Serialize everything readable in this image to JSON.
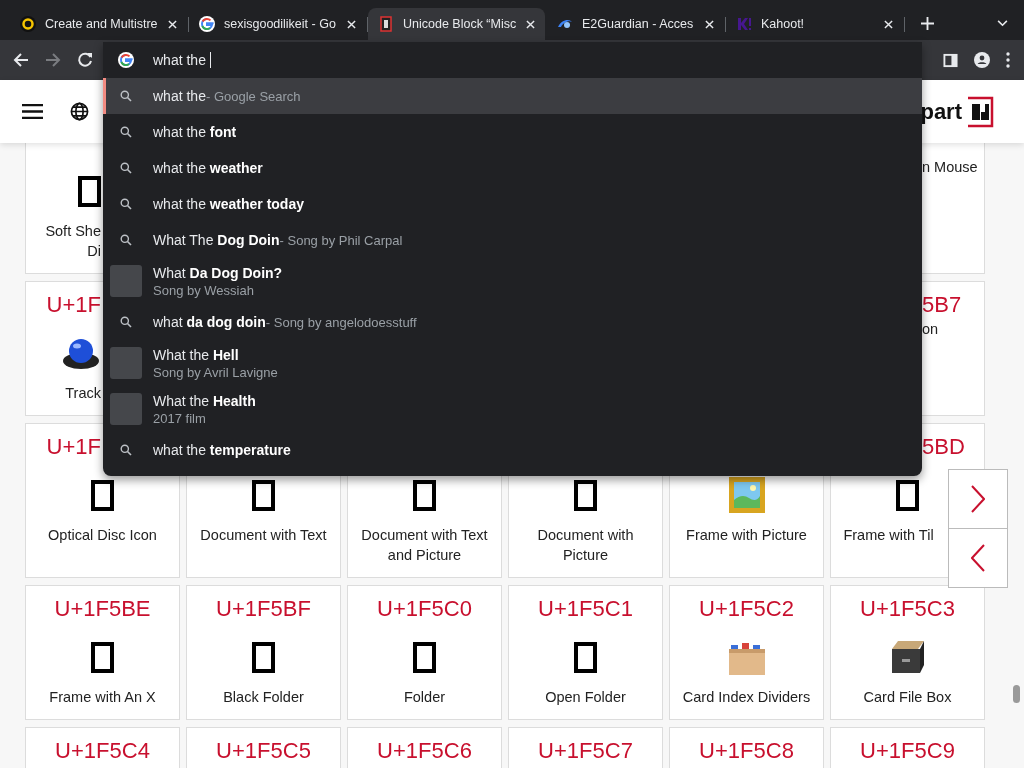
{
  "tabs": [
    {
      "title": "Create and Multistre",
      "kind": "ring",
      "selected": false
    },
    {
      "title": "sexisgoodilikeit - Go",
      "kind": "g",
      "selected": false
    },
    {
      "title": "Unicode Block “Misc",
      "kind": "frame",
      "selected": true
    },
    {
      "title": "E2Guardian - Acces",
      "kind": "swoosh",
      "selected": false
    },
    {
      "title": "Kahoot!",
      "kind": "k",
      "selected": false
    }
  ],
  "toolbar": {
    "forward_disabled": true
  },
  "omnibox": {
    "value": "what the"
  },
  "suggestions": [
    {
      "kind": "search",
      "text": "what the",
      "detail": "- Google Search",
      "selected": true
    },
    {
      "kind": "search",
      "text": "what the **font**",
      "selected": false
    },
    {
      "kind": "search",
      "text": "what the **weather**",
      "selected": false
    },
    {
      "kind": "search",
      "text": "what the **weather today**",
      "selected": false
    },
    {
      "kind": "search",
      "text": "What The **Dog Doin**",
      "detail": "- Song by Phil Carpal",
      "selected": false
    },
    {
      "kind": "thumb",
      "text": "What **Da Dog Doin?**",
      "detail": "Song by Wessiah",
      "selected": false
    },
    {
      "kind": "search",
      "text": "what **da dog doin**",
      "detail": "- Song by angelodoesstuff",
      "selected": false
    },
    {
      "kind": "thumb",
      "text": "What the **Hell**",
      "detail": "Song by Avril Lavigne",
      "selected": false
    },
    {
      "kind": "thumb",
      "text": "What the **Health**",
      "detail": "2017 film",
      "selected": false
    },
    {
      "kind": "search",
      "text": "what the **temperature**",
      "selected": false
    }
  ],
  "site_header": {
    "logo_text": "part"
  },
  "grid": {
    "rows": [
      {
        "cards": [
          {
            "kind": "missing",
            "label": "Soft She\nDi"
          },
          {
            "label": "n Mouse"
          }
        ]
      },
      {
        "cards": [
          {
            "code": "U+1F",
            "kind": "trackball",
            "label": "Track"
          },
          {
            "code": "5B7",
            "label": "on"
          }
        ]
      },
      {
        "cards": [
          {
            "code": "U+1F",
            "kind": "missing",
            "label": "Optical Disc Icon"
          },
          {
            "kind": "missing",
            "label": "Document with Text"
          },
          {
            "kind": "missing",
            "label": "Document with Text and Picture"
          },
          {
            "kind": "missing",
            "label": "Document with Picture"
          },
          {
            "kind": "framed-picture",
            "label": "Frame with Picture"
          },
          {
            "code": "5BD",
            "kind": "missing",
            "label": "Frame with Til"
          }
        ]
      },
      {
        "cards": [
          {
            "code": "U+1F5BE",
            "kind": "missing",
            "label": "Frame with An X"
          },
          {
            "code": "U+1F5BF",
            "kind": "missing",
            "label": "Black Folder"
          },
          {
            "code": "U+1F5C0",
            "kind": "missing",
            "label": "Folder"
          },
          {
            "code": "U+1F5C1",
            "kind": "missing",
            "label": "Open Folder"
          },
          {
            "code": "U+1F5C2",
            "kind": "card-index",
            "label": "Card Index Dividers"
          },
          {
            "code": "U+1F5C3",
            "kind": "card-file-box",
            "label": "Card File Box"
          }
        ]
      },
      {
        "cards": [
          {
            "code": "U+1F5C4"
          },
          {
            "code": "U+1F5C5"
          },
          {
            "code": "U+1F5C6"
          },
          {
            "code": "U+1F5C7"
          },
          {
            "code": "U+1F5C8"
          },
          {
            "code": "U+1F5C9"
          }
        ]
      }
    ]
  }
}
